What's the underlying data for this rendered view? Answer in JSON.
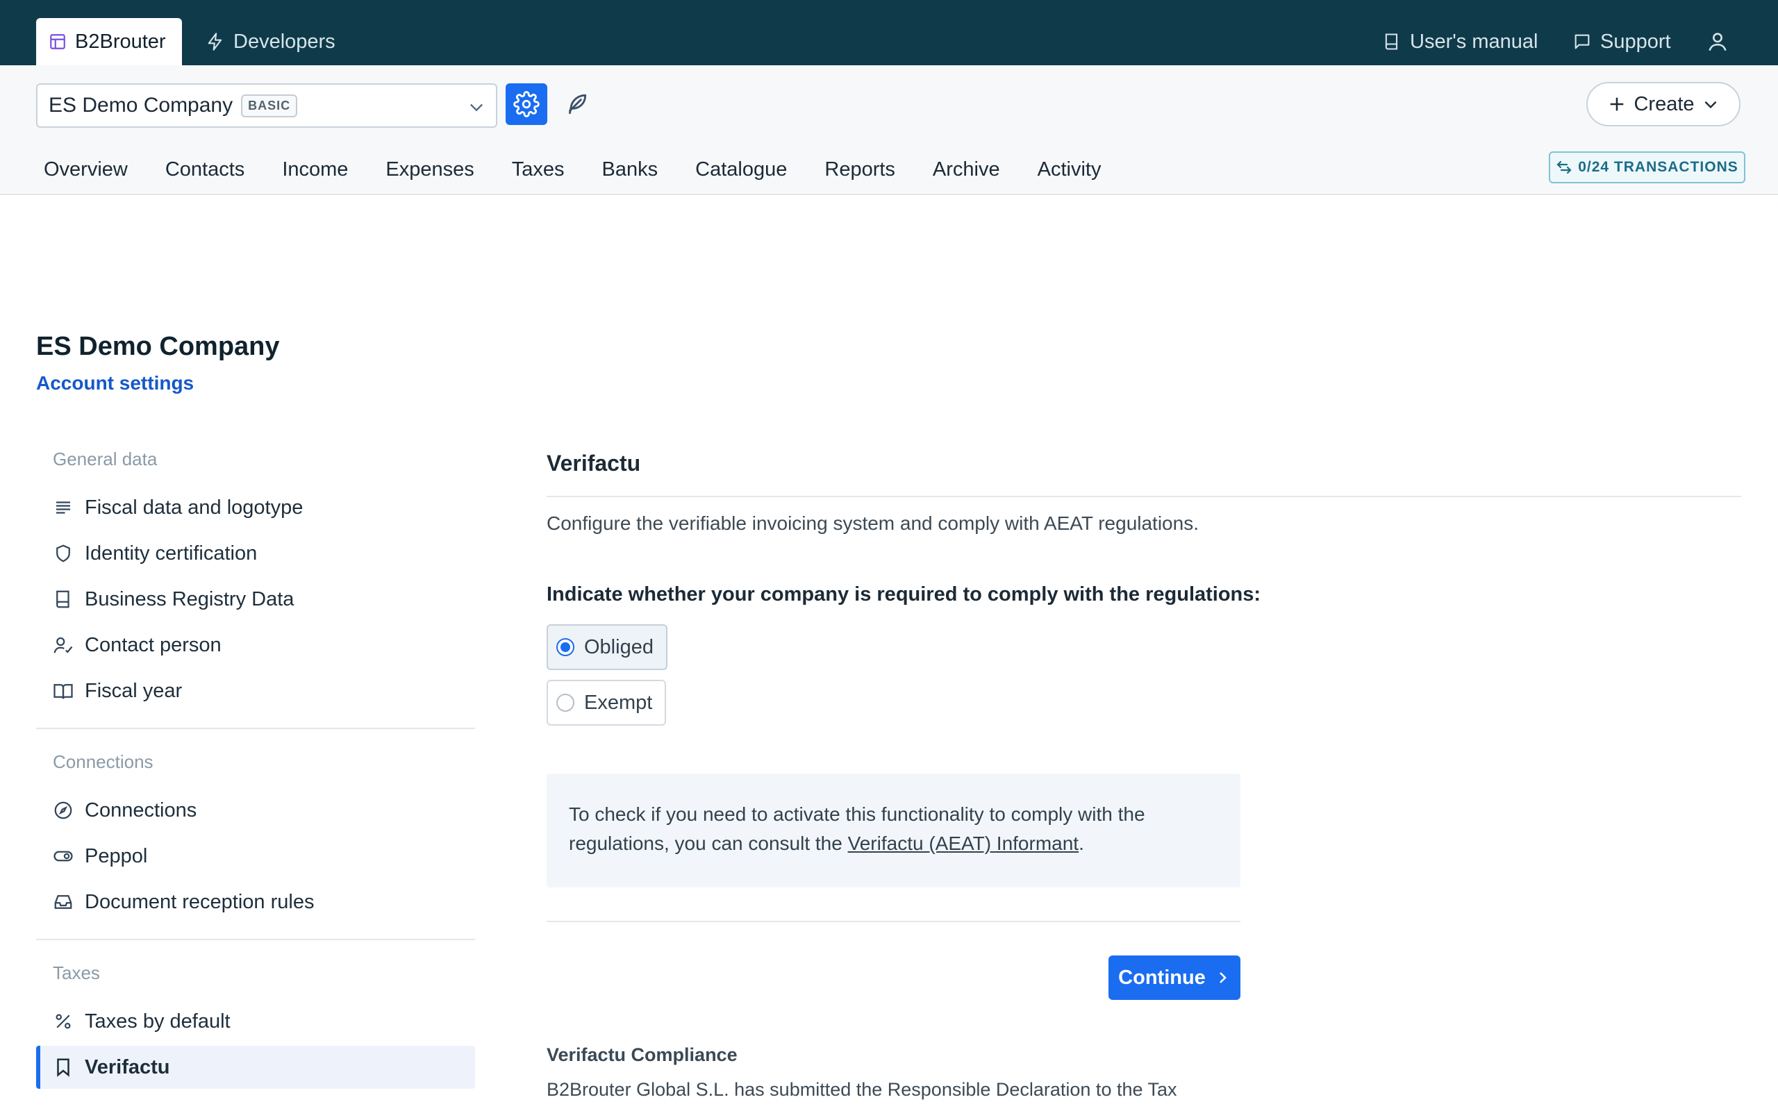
{
  "topbar": {
    "tabs": [
      {
        "label": "B2Brouter",
        "icon": "layout-icon",
        "active": true
      },
      {
        "label": "Developers",
        "icon": "bolt-icon",
        "active": false
      }
    ],
    "right": [
      {
        "label": "User's manual",
        "icon": "book-icon"
      },
      {
        "label": "Support",
        "icon": "chat-icon"
      }
    ]
  },
  "company_selector": {
    "name": "ES Demo Company",
    "plan": "BASIC"
  },
  "actions": {
    "create_label": "Create"
  },
  "nav": {
    "items": [
      "Overview",
      "Contacts",
      "Income",
      "Expenses",
      "Taxes",
      "Banks",
      "Catalogue",
      "Reports",
      "Archive",
      "Activity"
    ]
  },
  "transactions_badge": "0/24 TRANSACTIONS",
  "page": {
    "title": "ES Demo Company",
    "subtitle": "Account settings"
  },
  "sidebar": {
    "groups": [
      {
        "label": "General data",
        "items": [
          {
            "label": "Fiscal data and logotype",
            "icon": "text-lines-icon"
          },
          {
            "label": "Identity certification",
            "icon": "shield-icon"
          },
          {
            "label": "Business Registry Data",
            "icon": "book-icon"
          },
          {
            "label": "Contact person",
            "icon": "user-check-icon"
          },
          {
            "label": "Fiscal year",
            "icon": "open-book-icon"
          }
        ]
      },
      {
        "label": "Connections",
        "items": [
          {
            "label": "Connections",
            "icon": "compass-icon"
          },
          {
            "label": "Peppol",
            "icon": "toggle-icon"
          },
          {
            "label": "Document reception rules",
            "icon": "inbox-icon"
          }
        ]
      },
      {
        "label": "Taxes",
        "items": [
          {
            "label": "Taxes by default",
            "icon": "percent-icon"
          },
          {
            "label": "Verifactu",
            "icon": "bookmark-icon",
            "active": true
          }
        ]
      }
    ]
  },
  "main": {
    "section_title": "Verifactu",
    "description": "Configure the verifiable invoicing system and comply with AEAT regulations.",
    "question": "Indicate whether your company is required to comply with the regulations:",
    "options": [
      {
        "label": "Obliged",
        "selected": true
      },
      {
        "label": "Exempt",
        "selected": false
      }
    ],
    "info": {
      "text_before": "To check if you need to activate this functionality to comply with the regulations, you can consult the ",
      "link": "Verifactu (AEAT) Informant",
      "text_after": "."
    },
    "continue_label": "Continue",
    "compliance_title": "Verifactu Compliance",
    "compliance_text": "B2Brouter Global S.L. has submitted the Responsible Declaration to the Tax"
  },
  "colors": {
    "topbar": "#0f3a4a",
    "primary": "#1a6df0",
    "link": "#1558c9"
  }
}
